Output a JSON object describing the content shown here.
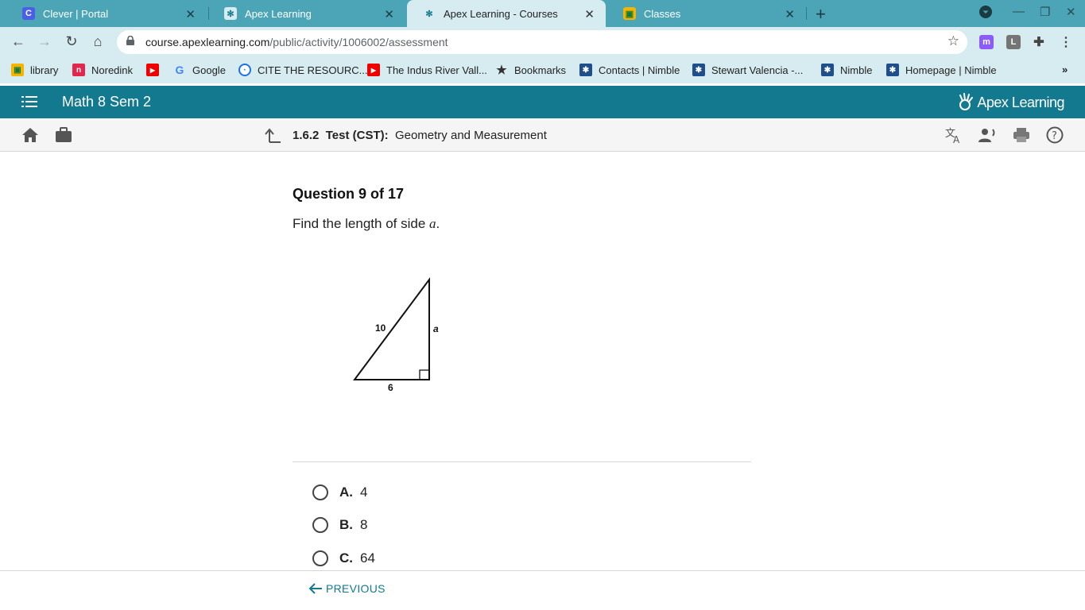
{
  "browser": {
    "tabs": [
      {
        "title": "Clever | Portal",
        "icon": "clever-icon",
        "icon_color": "#4a5ee8",
        "active": false
      },
      {
        "title": "Apex Learning",
        "icon": "apex-learning-icon",
        "icon_color": "#12798f",
        "active": false
      },
      {
        "title": "Apex Learning - Courses",
        "icon": "apex-learning-icon",
        "icon_color": "#12798f",
        "active": true
      },
      {
        "title": "Classes",
        "icon": "google-classroom-icon",
        "icon_color": "#f4b400",
        "active": false
      }
    ],
    "url_host": "course.apexlearning.com",
    "url_path": "/public/activity/1006002/assessment",
    "bookmarks": [
      {
        "label": "library",
        "icon": "google-classroom-icon"
      },
      {
        "label": "Noredink",
        "icon": "noredink-icon"
      },
      {
        "label": "",
        "icon": "youtube-icon"
      },
      {
        "label": "Google",
        "icon": "google-icon"
      },
      {
        "label": "CITE THE RESOURC...",
        "icon": "cite-icon"
      },
      {
        "label": "The Indus River Vall...",
        "icon": "youtube-icon"
      },
      {
        "label": "Bookmarks",
        "icon": "star-icon"
      },
      {
        "label": "Contacts | Nimble",
        "icon": "nimble-icon"
      },
      {
        "label": "Stewart Valencia -...",
        "icon": "nimble-icon"
      },
      {
        "label": "Nimble",
        "icon": "nimble-icon"
      },
      {
        "label": "Homepage | Nimble",
        "icon": "nimble-icon"
      }
    ],
    "overflow": "»"
  },
  "app": {
    "course_title": "Math 8 Sem 2",
    "brand": "Apex Learning",
    "brand_color": "#12798f"
  },
  "subbar": {
    "section": "1.6.2",
    "activity_type": "Test (CST):",
    "activity_name": "Geometry and Measurement"
  },
  "question": {
    "number_label": "Question 9 of 17",
    "prompt_text": "Find the length of side ",
    "prompt_var": "a",
    "prompt_end": ".",
    "figure": {
      "hypotenuse_label": "10",
      "side_label": "a",
      "base_label": "6"
    },
    "choices": [
      {
        "letter": "A.",
        "value": "4"
      },
      {
        "letter": "B.",
        "value": "8"
      },
      {
        "letter": "C.",
        "value": "64"
      }
    ]
  },
  "footer": {
    "previous_label": "PREVIOUS"
  }
}
